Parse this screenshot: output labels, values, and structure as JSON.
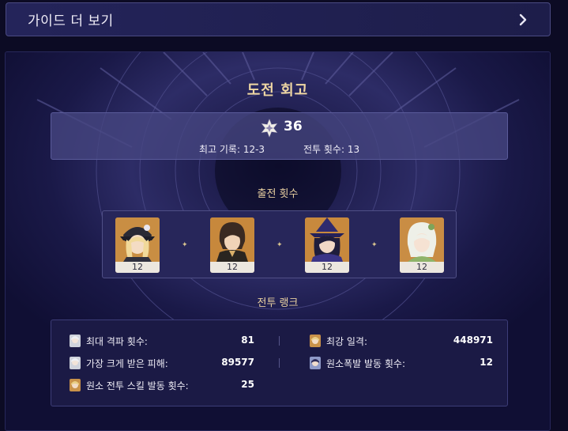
{
  "guide": {
    "label": "가이드 더 보기",
    "arrow_icon": "chevron-right-icon"
  },
  "challenge": {
    "title": "도전 회고",
    "star_icon": "abyss-star-icon",
    "stars": "36",
    "best_record": "최고 기록: 12-3",
    "battle_count": "전투 횟수: 13"
  },
  "party": {
    "title": "출전 횟수",
    "characters": [
      {
        "name": "Navia",
        "count": "12",
        "bg": "#c98e43"
      },
      {
        "name": "Zhongli",
        "count": "12",
        "bg": "#c7883c"
      },
      {
        "name": "Clorinde",
        "count": "12",
        "bg": "#c8893d"
      },
      {
        "name": "Nahida",
        "count": "12",
        "bg": "#c98d44"
      }
    ]
  },
  "ranks": {
    "title": "전투 랭크",
    "items": [
      {
        "label": "최대 격파 횟수:",
        "value": "81",
        "icon": "silver-haired-character-icon"
      },
      {
        "label": "최강 일격:",
        "value": "448971",
        "icon": "blonde-character-icon"
      },
      {
        "label": "가장 크게 받은 피해:",
        "value": "89577",
        "icon": "silver-haired-character-icon"
      },
      {
        "label": "원소폭발 발동 횟수:",
        "value": "12",
        "icon": "dark-haired-character-icon"
      },
      {
        "label": "원소 전투 스킬 발동 횟수:",
        "value": "25",
        "icon": "blonde-character-icon"
      }
    ]
  },
  "colors": {
    "background": "#0c0b24",
    "panel": "#11103a",
    "accent_gold": "#efd7a3"
  }
}
